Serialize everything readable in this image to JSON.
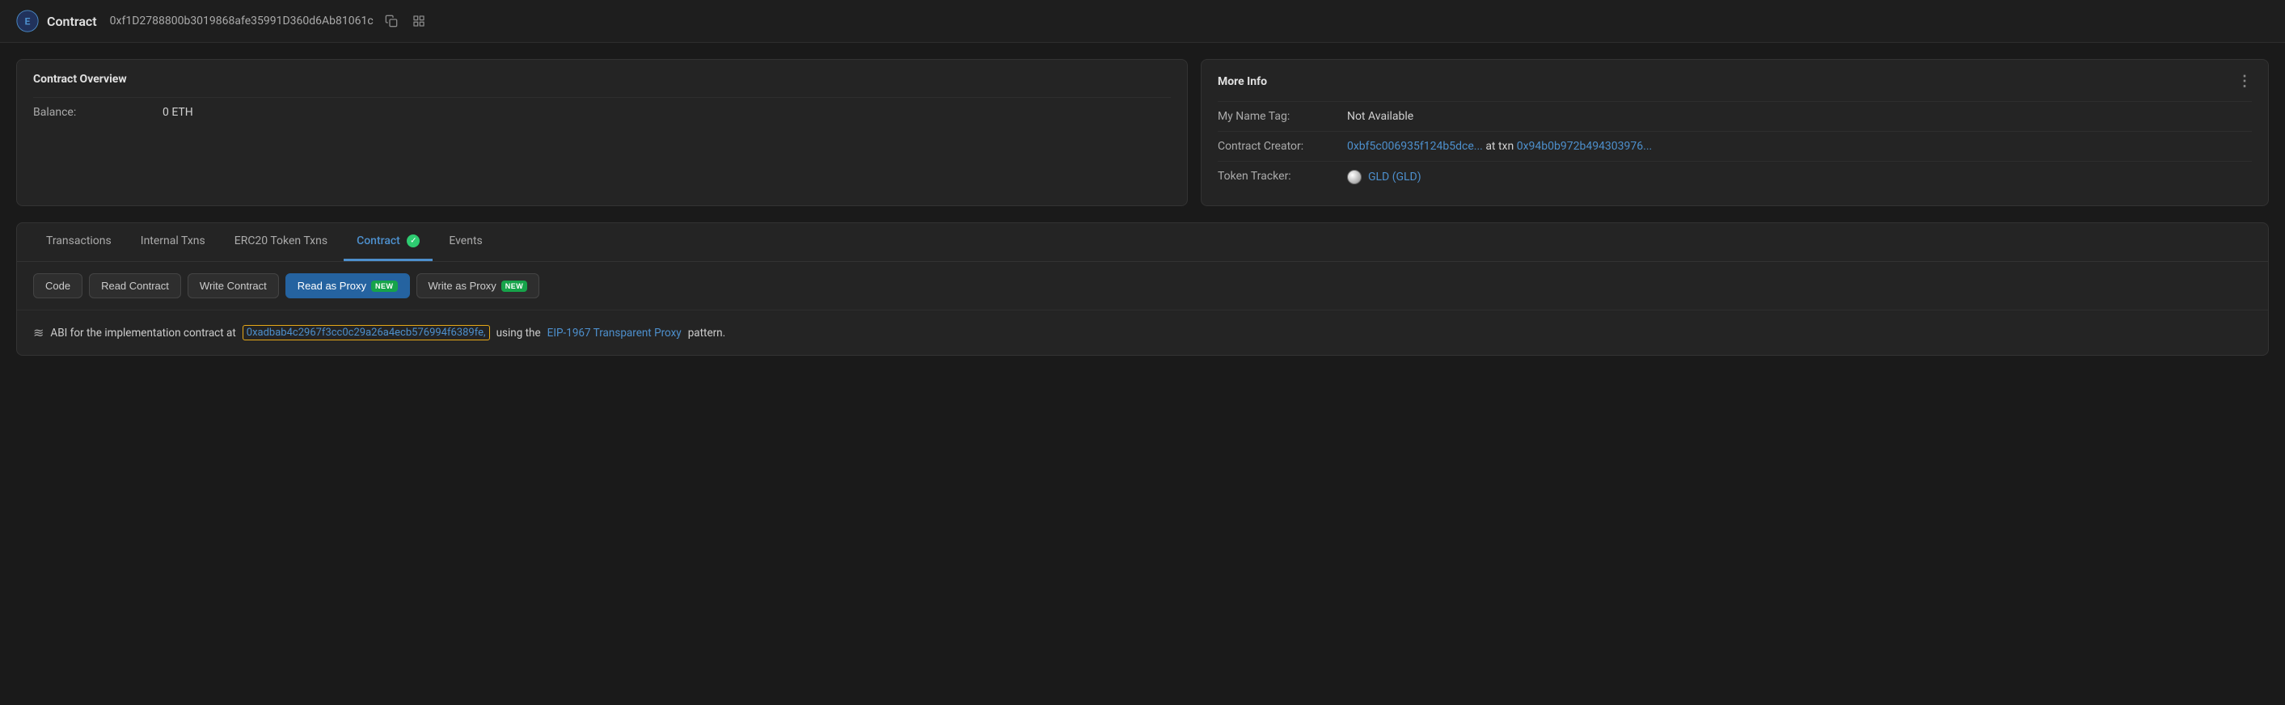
{
  "header": {
    "logo_alt": "Etherscan logo",
    "prefix": "Contract",
    "address": "0xf1D2788800b3019868afe35991D360d6Ab81061c",
    "copy_icon": "copy-icon",
    "grid_icon": "grid-icon"
  },
  "contract_overview": {
    "title": "Contract Overview",
    "balance_label": "Balance:",
    "balance_value": "0 ETH"
  },
  "more_info": {
    "title": "More Info",
    "name_tag_label": "My Name Tag:",
    "name_tag_value": "Not Available",
    "creator_label": "Contract Creator:",
    "creator_address": "0xbf5c006935f124b5dce...",
    "creator_at": "at txn",
    "creator_txn": "0x94b0b972b494303976...",
    "token_tracker_label": "Token Tracker:",
    "token_tracker_value": "GLD (GLD)"
  },
  "tabs": {
    "items": [
      {
        "id": "transactions",
        "label": "Transactions",
        "active": false
      },
      {
        "id": "internal-txns",
        "label": "Internal Txns",
        "active": false
      },
      {
        "id": "erc20-token-txns",
        "label": "ERC20 Token Txns",
        "active": false
      },
      {
        "id": "contract",
        "label": "Contract",
        "active": true,
        "verified": true
      },
      {
        "id": "events",
        "label": "Events",
        "active": false
      }
    ]
  },
  "subtabs": {
    "items": [
      {
        "id": "code",
        "label": "Code",
        "active": false,
        "new": false
      },
      {
        "id": "read-contract",
        "label": "Read Contract",
        "active": false,
        "new": false
      },
      {
        "id": "write-contract",
        "label": "Write Contract",
        "active": false,
        "new": false
      },
      {
        "id": "read-as-proxy",
        "label": "Read as Proxy",
        "active": true,
        "new": true
      },
      {
        "id": "write-as-proxy",
        "label": "Write as Proxy",
        "active": false,
        "new": true
      }
    ]
  },
  "abi_notice": {
    "icon": "≋",
    "text_before": "ABI for the implementation contract at",
    "address": "0xadbab4c2967f3cc0c29a26a4ecb576994f6389fe,",
    "text_middle": "using the",
    "link_text": "EIP-1967 Transparent Proxy",
    "text_after": "pattern."
  },
  "colors": {
    "active_tab": "#4d8fcc",
    "active_subtab_bg": "#2563a0",
    "new_badge_bg": "#16a34a",
    "abi_address_border": "#e6a817",
    "verified_badge": "#2ecc71"
  }
}
